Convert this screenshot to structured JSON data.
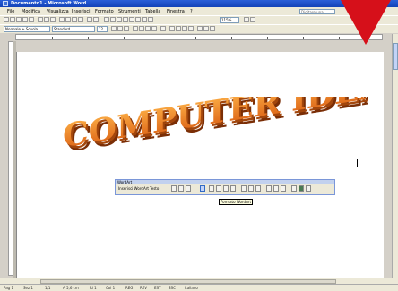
{
  "window": {
    "title": "Documento1 - Microsoft Word"
  },
  "menu": {
    "items": [
      "File",
      "Modifica",
      "Visualizza",
      "Inserisci",
      "Formato",
      "Strumenti",
      "Tabella",
      "Finestra",
      "?"
    ],
    "search_placeholder": "Digitare una domanda"
  },
  "formatting": {
    "style": "Normale + Scuola",
    "font": "Standard",
    "size": "12",
    "zoom": "115%"
  },
  "wordart": {
    "text": "COMPUTER IDEA"
  },
  "wordart_toolbar": {
    "title": "WordArt",
    "insert_label": "Inserisci WordArt",
    "text_label": "Testo"
  },
  "tooltip": {
    "text": "Formato WordArt"
  },
  "status": {
    "items": [
      "Pag 1",
      "Sez 1",
      "1/1",
      "A 5,6 cm",
      "Ri 1",
      "Col 1",
      "REG",
      "REV",
      "EST",
      "SSC",
      "Italiano"
    ]
  },
  "colors": {
    "wordart_fill": "#e8821e",
    "wordart_side": "#8a3a08",
    "arrow": "#d6101a",
    "titlebar": "#1a4cc0"
  }
}
